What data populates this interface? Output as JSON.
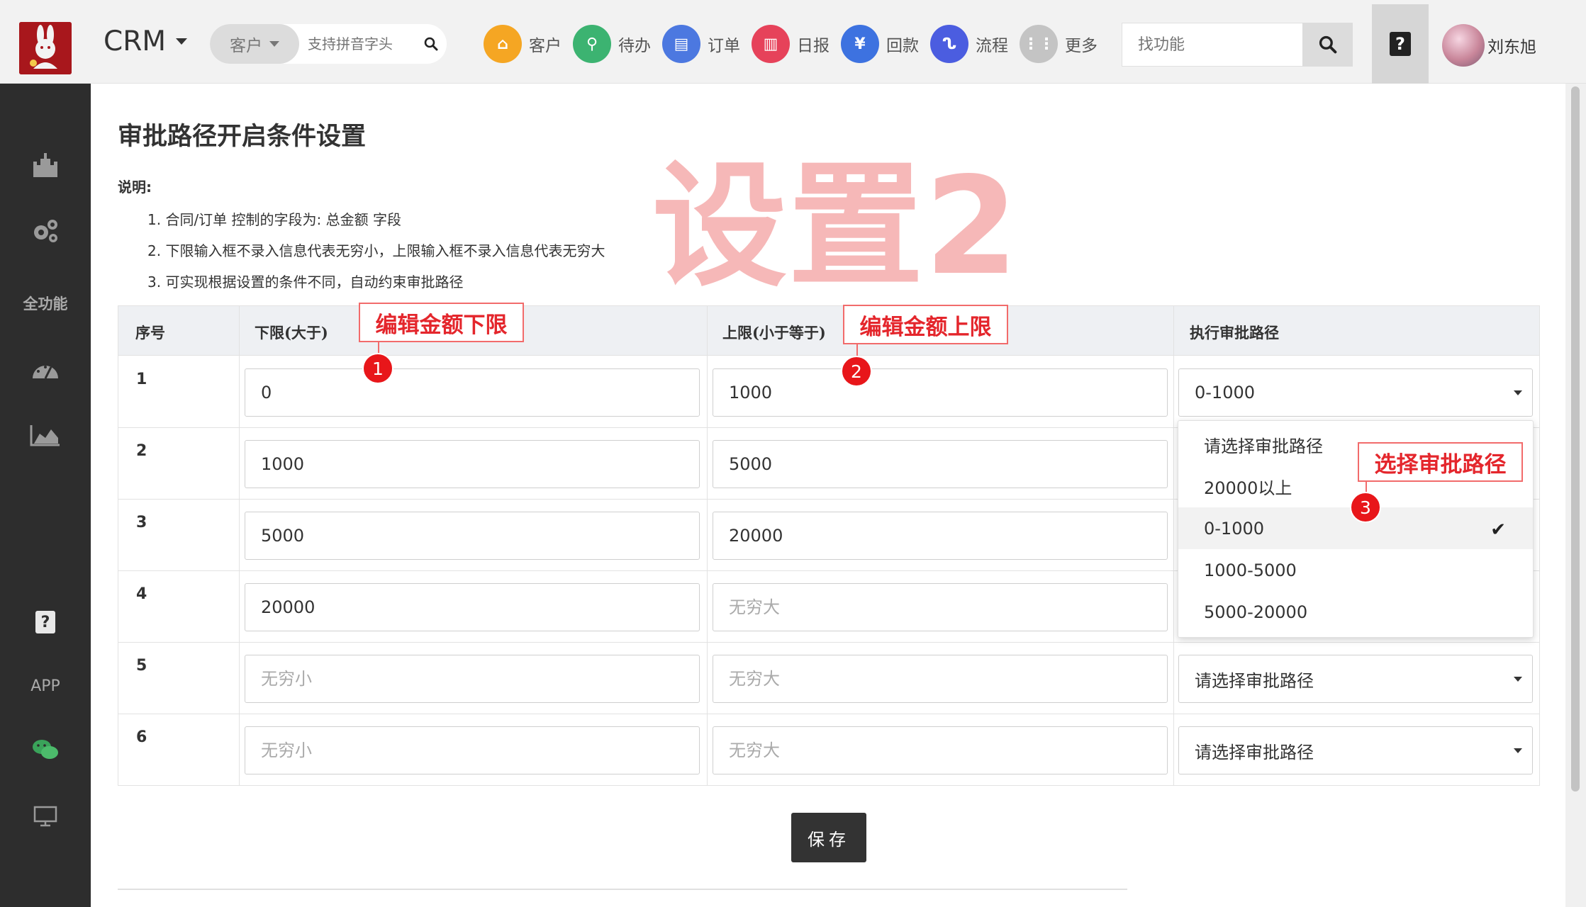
{
  "header": {
    "brand": "CRM",
    "search_scope": "客户",
    "search_placeholder": "支持拼音字头",
    "shortcuts": [
      {
        "label": "客户",
        "icon": "bank-icon",
        "color": "#f5a623",
        "glyph": "⌂"
      },
      {
        "label": "待办",
        "icon": "walking-person-icon",
        "color": "#3cb371",
        "glyph": "⚲"
      },
      {
        "label": "订单",
        "icon": "document-icon",
        "color": "#4c78e0",
        "glyph": "▤"
      },
      {
        "label": "日报",
        "icon": "report-icon",
        "color": "#e6425a",
        "glyph": "▥"
      },
      {
        "label": "回款",
        "icon": "yen-icon",
        "color": "#3d72e0",
        "glyph": "¥"
      },
      {
        "label": "流程",
        "icon": "flow-icon",
        "color": "#4b5de0",
        "glyph": "ᔐ"
      },
      {
        "label": "更多",
        "icon": "grid-icon",
        "color": "#c4c4c4",
        "glyph": "⋮⋮"
      }
    ],
    "find_placeholder": "找功能",
    "help_glyph": "?",
    "username": "刘东旭"
  },
  "sidebar": {
    "items": [
      {
        "name": "castle-icon",
        "glyph": "♜"
      },
      {
        "name": "gears-icon",
        "glyph": "⚙"
      },
      {
        "name": "all-functions-label",
        "text": "全功能"
      },
      {
        "name": "dashboard-icon",
        "glyph": "◔"
      },
      {
        "name": "area-chart-icon",
        "glyph": "◢"
      },
      {
        "name": "help-icon",
        "glyph": "?"
      },
      {
        "name": "app-label",
        "text": "APP"
      },
      {
        "name": "wechat-icon",
        "glyph": "◍"
      },
      {
        "name": "monitor-icon",
        "glyph": "▭"
      }
    ]
  },
  "page": {
    "title": "审批路径开启条件设置",
    "note_label": "说明:",
    "notes": [
      "1.  合同/订单 控制的字段为: 总金额 字段",
      "2.  下限输入框不录入信息代表无穷小，上限输入框不录入信息代表无穷大",
      "3.  可实现根据设置的条件不同，自动约束审批路径"
    ],
    "watermark": "设置2",
    "save_label": "保存"
  },
  "table": {
    "headers": {
      "index": "序号",
      "lower": "下限(大于)",
      "upper": "上限(小于等于)",
      "path": "执行审批路径"
    },
    "lower_placeholder": "无穷小",
    "upper_placeholder": "无穷大",
    "path_placeholder": "请选择审批路径",
    "rows": [
      {
        "index": "1",
        "lower": "0",
        "upper": "1000",
        "path": "0-1000"
      },
      {
        "index": "2",
        "lower": "1000",
        "upper": "5000",
        "path": ""
      },
      {
        "index": "3",
        "lower": "5000",
        "upper": "20000",
        "path": ""
      },
      {
        "index": "4",
        "lower": "20000",
        "upper": "",
        "path": ""
      },
      {
        "index": "5",
        "lower": "",
        "upper": "",
        "path": "请选择审批路径"
      },
      {
        "index": "6",
        "lower": "",
        "upper": "",
        "path": "请选择审批路径"
      }
    ]
  },
  "dropdown": {
    "options": [
      "请选择审批路径",
      "20000以上",
      "0-1000",
      "1000-5000",
      "5000-20000"
    ],
    "selected": "0-1000",
    "check_glyph": "✔"
  },
  "annotations": {
    "lower": {
      "number": "1",
      "text": "编辑金额下限"
    },
    "upper": {
      "number": "2",
      "text": "编辑金额上限"
    },
    "path": {
      "number": "3",
      "text": "选择审批路径"
    }
  },
  "colors": {
    "sidebar_bg": "#2d2d2d",
    "annotation_red": "#e4262c",
    "watermark": "#f6b8b8",
    "save_button": "#333333"
  }
}
